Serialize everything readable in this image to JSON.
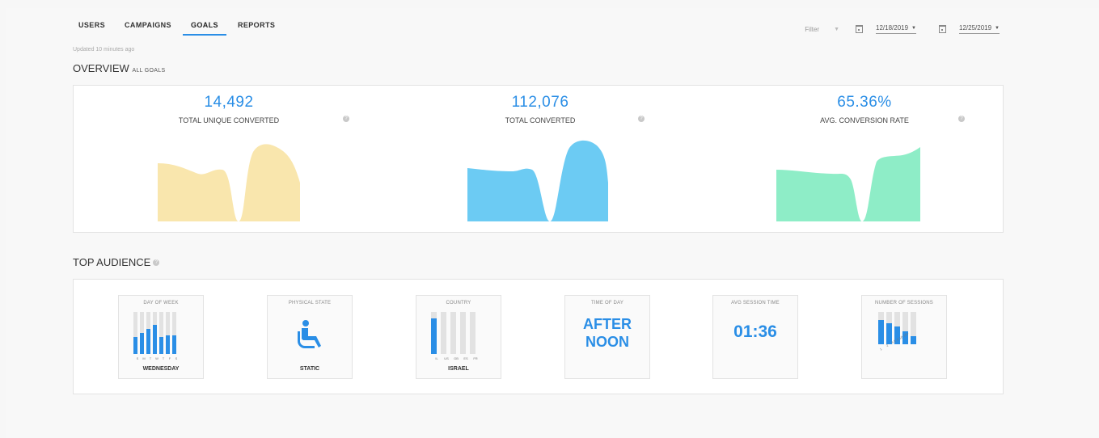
{
  "tabs": [
    "USERS",
    "CAMPAIGNS",
    "GOALS",
    "REPORTS"
  ],
  "active_tab": "GOALS",
  "filter": {
    "label": "Filter",
    "start_date": "12/18/2019",
    "end_date": "12/25/2019"
  },
  "updated": "Updated 10 minutes ago",
  "overview": {
    "title": "OVERVIEW",
    "subtitle": "ALL GOALS",
    "metrics": [
      {
        "value": "14,492",
        "label": "TOTAL UNIQUE CONVERTED",
        "color": "#f9e6ad"
      },
      {
        "value": "112,076",
        "label": "TOTAL CONVERTED",
        "color": "#6ccbf3"
      },
      {
        "value": "65.36%",
        "label": "AVG. CONVERSION RATE",
        "color": "#8eedc7"
      }
    ]
  },
  "audience": {
    "title": "TOP AUDIENCE",
    "tiles": [
      {
        "header": "DAY OF WEEK",
        "footer": "WEDNESDAY",
        "ticks": [
          "S",
          "M",
          "T",
          "W",
          "T",
          "F",
          "S"
        ],
        "levels": [
          0.4,
          0.5,
          0.6,
          0.7,
          0.4,
          0.45,
          0.45
        ]
      },
      {
        "header": "PHYSICAL STATE",
        "footer": "STATIC",
        "icon": "wheelchair-icon"
      },
      {
        "header": "COUNTRY",
        "footer": "ISRAEL",
        "ticks": [
          "IL",
          "US",
          "GB",
          "ES",
          "FR"
        ],
        "levels": [
          0.85,
          0.0,
          0.0,
          0.0,
          0.0
        ]
      },
      {
        "header": "TIME OF DAY",
        "line1": "AFTER",
        "line2": "NOON"
      },
      {
        "header": "AVG SESSION TIME",
        "value": "01:36"
      },
      {
        "header": "NUMBER OF SESSIONS",
        "ticks": [
          "1",
          "2",
          "3-5",
          "6-10",
          "10+"
        ],
        "levels": [
          0.75,
          0.65,
          0.55,
          0.4,
          0.25
        ]
      }
    ]
  },
  "accent": "#2a8ee6"
}
